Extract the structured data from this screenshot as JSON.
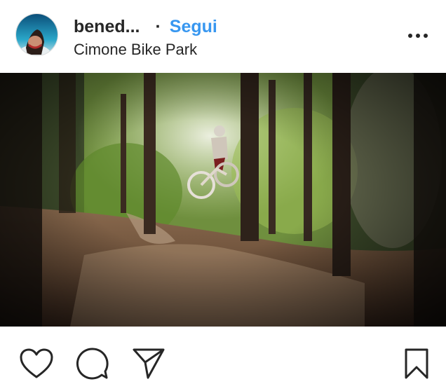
{
  "post": {
    "username": "bened...",
    "separator": "·",
    "follow_label": "Segui",
    "location": "Cimone Bike Park"
  },
  "icons": {
    "more": "more-options-icon",
    "like": "heart-icon",
    "comment": "comment-bubble-icon",
    "share": "paper-plane-icon",
    "save": "bookmark-icon"
  },
  "colors": {
    "follow_blue": "#3897f0",
    "text": "#262626"
  }
}
